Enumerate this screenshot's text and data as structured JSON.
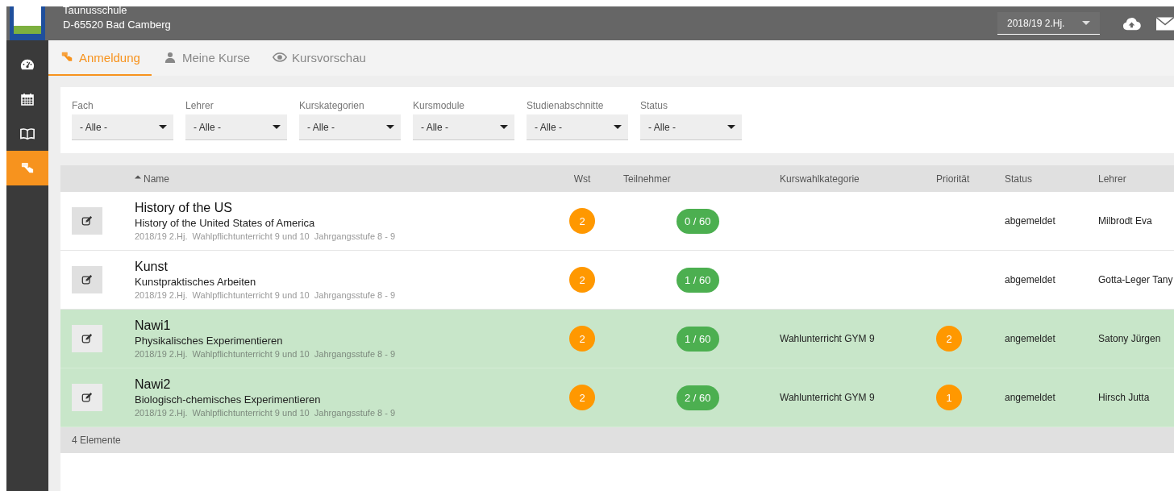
{
  "header": {
    "school_name": "Taunusschule",
    "school_address": "D-65520 Bad Camberg",
    "term_select": {
      "value": "2018/19 2.Hj."
    }
  },
  "sidebar": {
    "items": [
      {
        "kind": "dashboard",
        "selected": false
      },
      {
        "kind": "calendar",
        "selected": false
      },
      {
        "kind": "book",
        "selected": false
      },
      {
        "kind": "register",
        "selected": true
      }
    ]
  },
  "tabs": [
    {
      "kind": "register",
      "label": "Anmeldung",
      "selected": true
    },
    {
      "kind": "person",
      "label": "Meine Kurse",
      "selected": false
    },
    {
      "kind": "eye",
      "label": "Kursvorschau",
      "selected": false
    }
  ],
  "filters": [
    {
      "label": "Fach",
      "value": "- Alle -"
    },
    {
      "label": "Lehrer",
      "value": "- Alle -"
    },
    {
      "label": "Kurskategorien",
      "value": "- Alle -"
    },
    {
      "label": "Kursmodule",
      "value": "- Alle -"
    },
    {
      "label": "Studienabschnitte",
      "value": "- Alle -"
    },
    {
      "label": "Status",
      "value": "- Alle -"
    }
  ],
  "table": {
    "columns": [
      "Name",
      "Wst",
      "Teilnehmer",
      "Kurswahlkategorie",
      "Priorität",
      "Status",
      "Lehrer"
    ],
    "rows": [
      {
        "title": "History of the US",
        "subtitle": "History of the United States of America",
        "details": "2018/19 2.Hj.  Wahlpflichtunterricht 9 und 10  Jahrgangsstufe 8 - 9",
        "wst": "2",
        "participants": "0 / 60",
        "category": "",
        "priority": "",
        "status": "abgemeldet",
        "teacher": "Milbrodt Eva",
        "registered": false
      },
      {
        "title": "Kunst",
        "subtitle": "Kunstpraktisches Arbeiten",
        "details": "2018/19 2.Hj.  Wahlpflichtunterricht 9 und 10  Jahrgangsstufe 8 - 9",
        "wst": "2",
        "participants": "1 / 60",
        "category": "",
        "priority": "",
        "status": "abgemeldet",
        "teacher": "Gotta-Leger Tany",
        "registered": false
      },
      {
        "title": "Nawi1",
        "subtitle": "Physikalisches Experimentieren",
        "details": "2018/19 2.Hj.  Wahlpflichtunterricht 9 und 10  Jahrgangsstufe 8 - 9",
        "wst": "2",
        "participants": "1 / 60",
        "category": "Wahlunterricht GYM 9",
        "priority": "2",
        "status": "angemeldet",
        "teacher": "Satony Jürgen",
        "registered": true
      },
      {
        "title": "Nawi2",
        "subtitle": "Biologisch-chemisches Experimentieren",
        "details": "2018/19 2.Hj.  Wahlpflichtunterricht 9 und 10  Jahrgangsstufe 8 - 9",
        "wst": "2",
        "participants": "2 / 60",
        "category": "Wahlunterricht GYM 9",
        "priority": "1",
        "status": "angemeldet",
        "teacher": "Hirsch Jutta",
        "registered": true
      }
    ],
    "footer": "4 Elemente"
  }
}
